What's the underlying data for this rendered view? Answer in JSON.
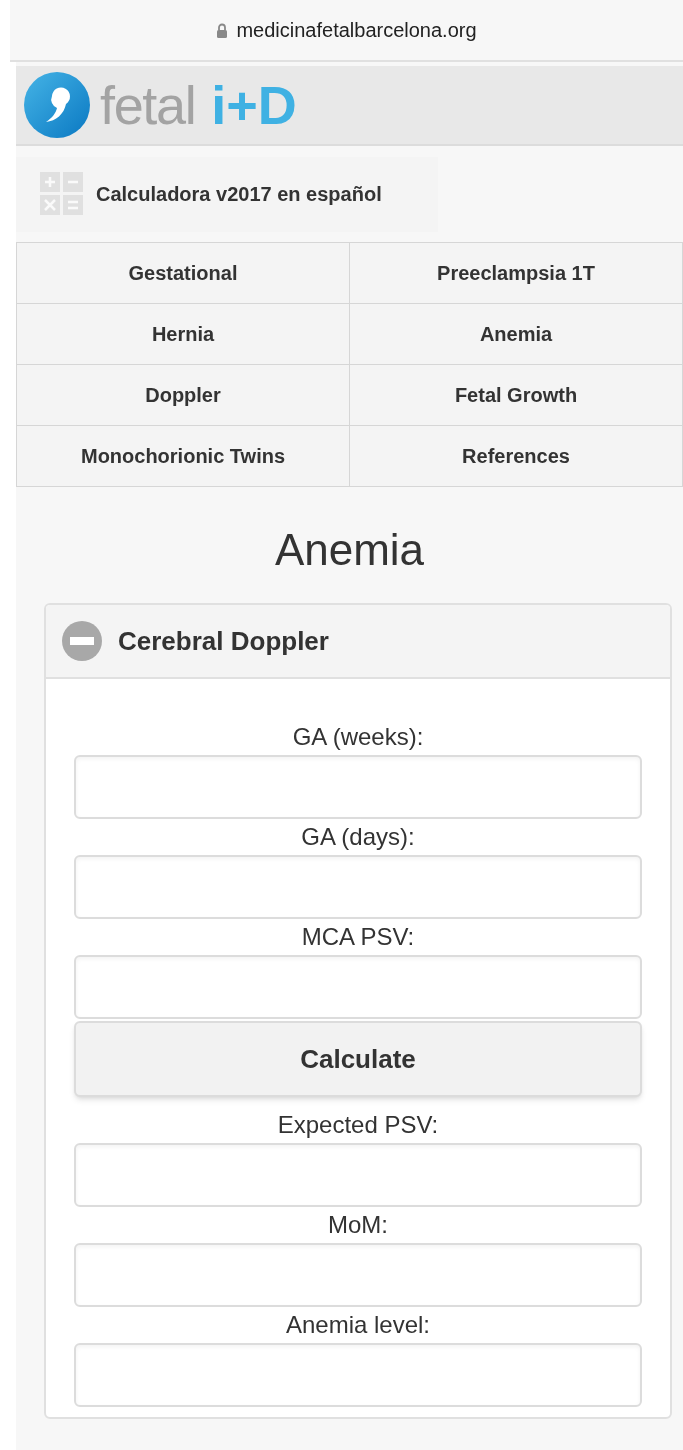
{
  "address_bar": {
    "url": "medicinafetalbarcelona.org"
  },
  "logo": {
    "word": "fetal",
    "mark": "i+D"
  },
  "calculator_link": {
    "label": "Calculadora v2017 en español"
  },
  "nav": [
    {
      "label": "Gestational"
    },
    {
      "label": "Preeclampsia 1T"
    },
    {
      "label": "Hernia"
    },
    {
      "label": "Anemia"
    },
    {
      "label": "Doppler"
    },
    {
      "label": "Fetal Growth"
    },
    {
      "label": "Monochorionic Twins"
    },
    {
      "label": "References"
    }
  ],
  "page_title": "Anemia",
  "panel": {
    "title": "Cerebral Doppler",
    "expanded": true,
    "items": [
      {
        "kind": "field",
        "label": "GA (weeks):"
      },
      {
        "kind": "field",
        "label": "GA (days):"
      },
      {
        "kind": "field",
        "label": "MCA PSV:"
      },
      {
        "kind": "button",
        "label": "Calculate"
      },
      {
        "kind": "field",
        "label": "Expected PSV:"
      },
      {
        "kind": "field",
        "label": "MoM:"
      },
      {
        "kind": "field",
        "label": "Anemia level:"
      }
    ]
  }
}
